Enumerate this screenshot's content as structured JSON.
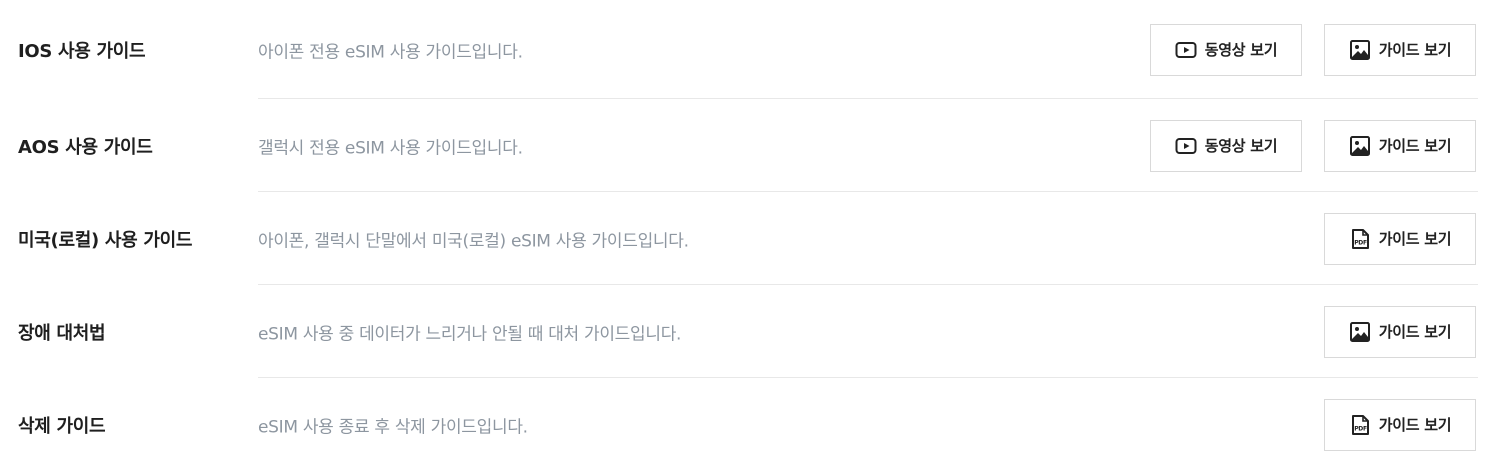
{
  "guides": [
    {
      "title": "IOS 사용 가이드",
      "description": "아이폰 전용 eSIM 사용 가이드입니다.",
      "video_label": "동영상 보기",
      "guide_label": "가이드 보기",
      "guide_icon": "image-icon"
    },
    {
      "title": "AOS 사용 가이드",
      "description": "갤럭시 전용 eSIM 사용 가이드입니다.",
      "video_label": "동영상 보기",
      "guide_label": "가이드 보기",
      "guide_icon": "image-icon"
    },
    {
      "title": "미국(로컬) 사용 가이드",
      "description": "아이폰, 갤럭시 단말에서 미국(로컬) eSIM 사용 가이드입니다.",
      "guide_label": "가이드 보기",
      "guide_icon": "pdf-icon"
    },
    {
      "title": "장애 대처법",
      "description": "eSIM 사용 중 데이터가 느리거나 안될 때 대처 가이드입니다.",
      "guide_label": "가이드 보기",
      "guide_icon": "image-icon"
    },
    {
      "title": "삭제 가이드",
      "description": "eSIM 사용 종료 후 삭제 가이드입니다.",
      "guide_label": "가이드 보기",
      "guide_icon": "pdf-icon"
    }
  ],
  "icons": {
    "video": "play-icon",
    "pdf_text": "PDF"
  },
  "colors": {
    "title": "#1f1f1f",
    "description": "#8d96a0",
    "border": "#d9d9d9",
    "divider": "#e8e8e8"
  }
}
